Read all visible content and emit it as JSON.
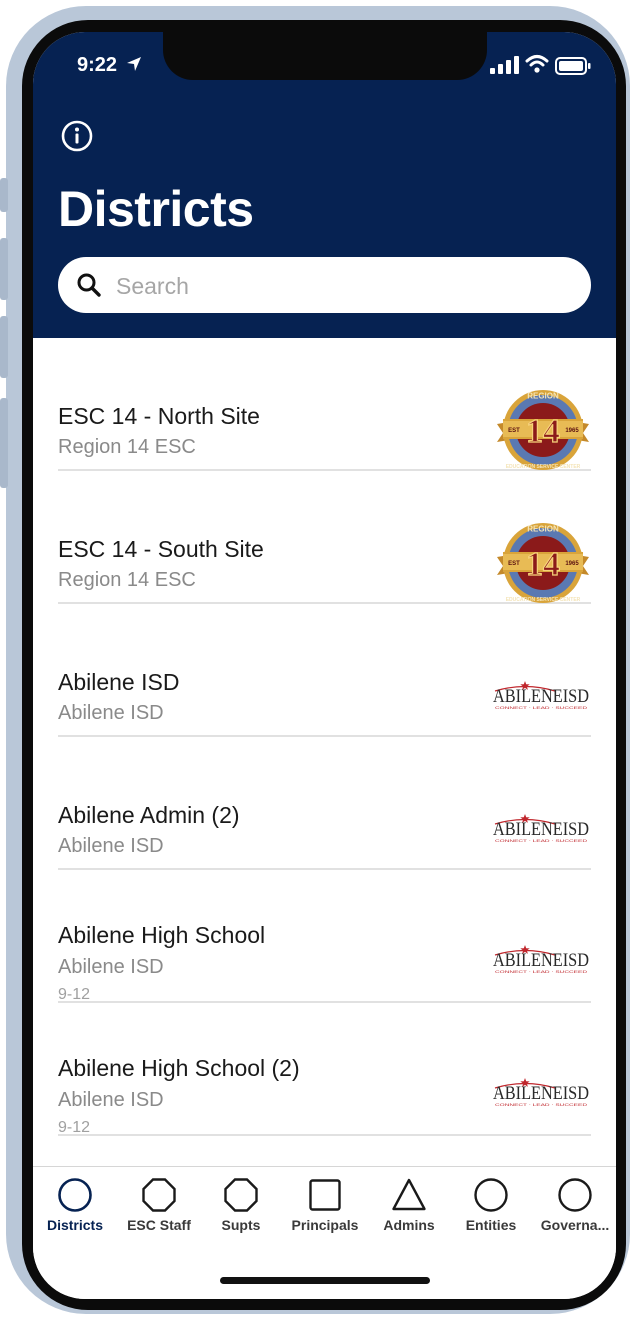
{
  "status_bar": {
    "time": "9:22"
  },
  "header": {
    "title": "Districts",
    "search_placeholder": "Search"
  },
  "list": [
    {
      "title": "ESC 14 - North Site",
      "subtitle": "Region 14 ESC",
      "grade": "",
      "logo": "region-14-seal"
    },
    {
      "title": "ESC 14 - South Site",
      "subtitle": "Region 14 ESC",
      "grade": "",
      "logo": "region-14-seal"
    },
    {
      "title": "Abilene ISD",
      "subtitle": "Abilene ISD",
      "grade": "",
      "logo": "abilene-isd-wordmark"
    },
    {
      "title": "Abilene Admin (2)",
      "subtitle": "Abilene ISD",
      "grade": "",
      "logo": "abilene-isd-wordmark"
    },
    {
      "title": "Abilene High School",
      "subtitle": "Abilene ISD",
      "grade": "9-12",
      "logo": "abilene-isd-wordmark"
    },
    {
      "title": "Abilene High School (2)",
      "subtitle": "Abilene ISD",
      "grade": "9-12",
      "logo": "abilene-isd-wordmark"
    }
  ],
  "logos": {
    "region14": {
      "number": "14",
      "top_text": "REGION",
      "bottom_text": "EDUCATION SERVICE CENTER",
      "left_text": "EST",
      "right_text": "1965"
    },
    "abilene": {
      "wordmark": "ABILENEISD",
      "tagline": "CONNECT · LEAD · SUCCEED"
    }
  },
  "tabs": [
    {
      "label": "Districts",
      "shape": "circle-icon",
      "active": true
    },
    {
      "label": "ESC Staff",
      "shape": "octagon-icon",
      "active": false
    },
    {
      "label": "Supts",
      "shape": "octagon-icon",
      "active": false
    },
    {
      "label": "Principals",
      "shape": "square-icon",
      "active": false
    },
    {
      "label": "Admins",
      "shape": "triangle-icon",
      "active": false
    },
    {
      "label": "Entities",
      "shape": "circle-icon",
      "active": false
    },
    {
      "label": "Governa...",
      "shape": "circle-icon",
      "active": false
    }
  ],
  "colors": {
    "header_bg": "#062252",
    "active_tab": "#062252",
    "seal_maroon": "#8b1a1a",
    "seal_gold": "#d9a43a",
    "seal_blue": "#5a79b2",
    "abilene_red": "#c0272d"
  }
}
